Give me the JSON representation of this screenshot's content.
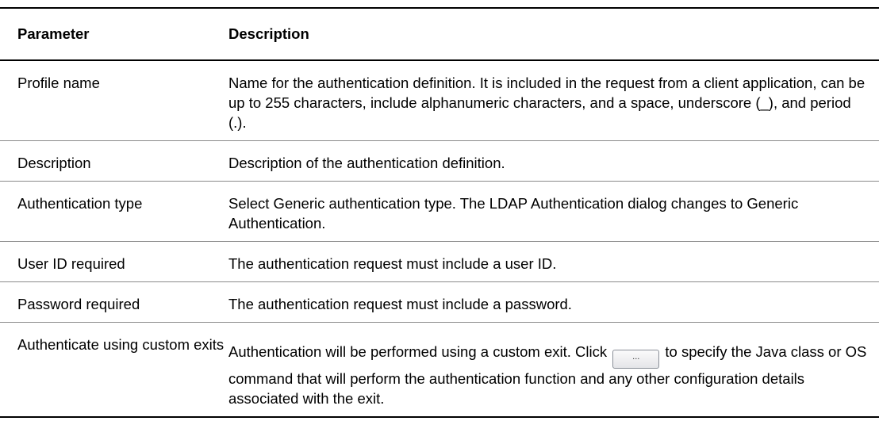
{
  "table": {
    "headers": {
      "parameter": "Parameter",
      "description": "Description"
    },
    "rows": [
      {
        "parameter": "Profile name",
        "description": "Name for the authentication definition. It is included in the request from a client application, can be up to 255 characters, include alphanumeric characters, and a space, underscore (_), and period (.)."
      },
      {
        "parameter": "Description",
        "description": "Description of the authentication definition."
      },
      {
        "parameter": "Authentication type",
        "description": "Select Generic authentication type. The LDAP Authentication dialog changes to Generic Authentication."
      },
      {
        "parameter": "User ID required",
        "description": "The authentication request must include a user ID."
      },
      {
        "parameter": "Password required",
        "description": "The authentication request must include a password."
      },
      {
        "parameter": "Authenticate using custom exits",
        "description_before": "Authentication will be performed using a custom exit. Click",
        "button_label": "...",
        "description_after": "to specify the Java class or OS command that will perform the authentication function and any other configuration details associated with the exit."
      }
    ]
  }
}
